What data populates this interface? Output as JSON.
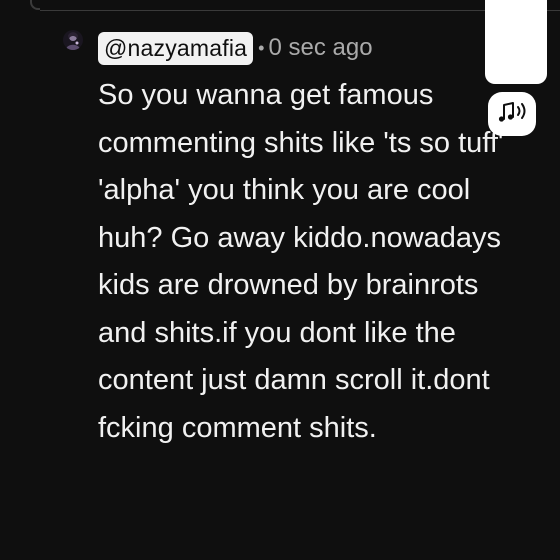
{
  "comment": {
    "author_handle": "@nazyamafia",
    "separator": "•",
    "timestamp": "0 sec ago",
    "text": "So you wanna get famous commenting shits like 'ts so tuff' 'alpha' you think you are cool huh? Go away kiddo.nowadays kids are drowned by brainrots and shits.if you dont like the content just damn scroll it.dont fcking comment shits."
  },
  "colors": {
    "background": "#0f0f0f",
    "text": "#f1f1f1",
    "muted_text": "#aaaaaa",
    "handle_chip_bg": "#f2f2f2"
  },
  "icons": {
    "avatar": "avatar-icon",
    "audio": "music-note-sound-icon"
  }
}
